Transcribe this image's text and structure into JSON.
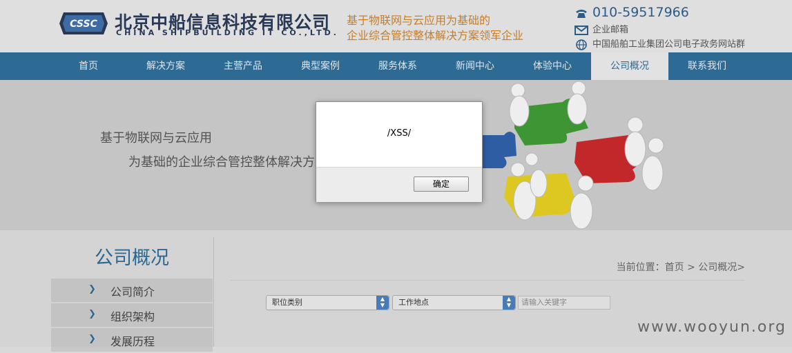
{
  "header": {
    "logo_badge": "CSSC",
    "logo_cn": "北京中船信息科技有限公司",
    "logo_en": "CHINA SHIPBUILDING IT CO.,LTD.",
    "slogan_line1": "基于物联网与云应用为基础的",
    "slogan_line2": "企业综合管控整体解决方案领军企业",
    "phone": "010-59517966",
    "mail_label": "企业邮箱",
    "site_label": "中国船舶工业集团公司电子政务网站群"
  },
  "nav": {
    "items": [
      "首页",
      "解决方案",
      "主营产品",
      "典型案例",
      "服务体系",
      "新闻中心",
      "体验中心",
      "公司概况",
      "联系我们"
    ],
    "active": "公司概况"
  },
  "banner": {
    "line1": "基于物联网与云应用",
    "line2": "为基础的企业综合管控整体解决方案领军企业"
  },
  "sidebar": {
    "title": "公司概况",
    "items": [
      "公司简介",
      "组织架构",
      "发展历程"
    ]
  },
  "breadcrumb": "当前位置：首页 > 公司概况>",
  "filters": {
    "job_category": "职位类别",
    "work_location": "工作地点",
    "keyword_placeholder": "请输入关键字"
  },
  "dialog": {
    "message": "/XSS/",
    "ok_label": "确定"
  },
  "watermark": "www.wooyun.org",
  "colors": {
    "nav_bg": "#2e6d97",
    "brand_blue": "#2a3b57",
    "slogan_orange": "#c7812f"
  }
}
